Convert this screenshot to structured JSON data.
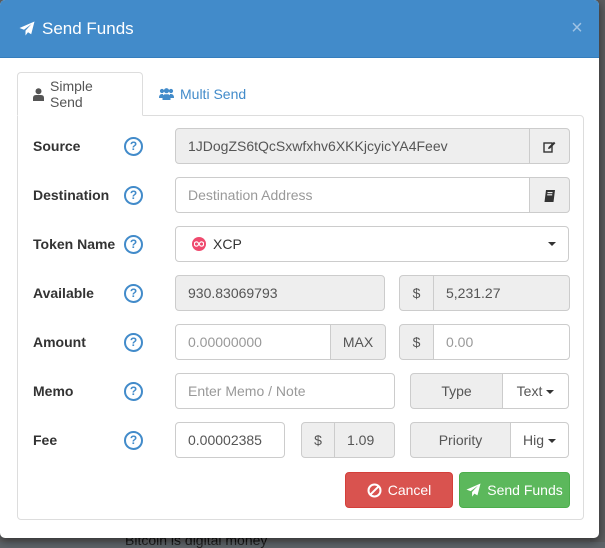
{
  "background": {
    "bottom_text": "Bitcoin is digital money"
  },
  "modal": {
    "title": "Send Funds",
    "title_icon": "paper-plane-icon",
    "close_label": "×"
  },
  "tabs": [
    {
      "label": "Simple Send",
      "icon": "user-icon",
      "active": true
    },
    {
      "label": "Multi Send",
      "icon": "users-icon",
      "active": false
    }
  ],
  "form": {
    "source": {
      "label": "Source",
      "value": "1JDogZS6tQcSxwfxhv6XKKjcyicYA4Feev",
      "action_icon": "edit-icon"
    },
    "destination": {
      "label": "Destination",
      "placeholder": "Destination Address",
      "action_icon": "address-book-icon"
    },
    "token": {
      "label": "Token Name",
      "value": "XCP"
    },
    "available": {
      "label": "Available",
      "value": "930.83069793",
      "currency_symbol": "$",
      "usd_value": "5,231.27"
    },
    "amount": {
      "label": "Amount",
      "placeholder": "0.00000000",
      "max_label": "MAX",
      "currency_symbol": "$",
      "usd_placeholder": "0.00"
    },
    "memo": {
      "label": "Memo",
      "placeholder": "Enter Memo / Note",
      "type_label": "Type",
      "type_value": "Text"
    },
    "fee": {
      "label": "Fee",
      "value": "0.00002385",
      "currency_symbol": "$",
      "usd_value": "1.09",
      "priority_label": "Priority",
      "priority_value": "Hig"
    },
    "help_glyph": "?"
  },
  "actions": {
    "cancel_label": "Cancel",
    "send_label": "Send Funds"
  },
  "colors": {
    "header": "#428bca",
    "cancel": "#d9534f",
    "send": "#5cb85c",
    "link": "#428bca"
  }
}
